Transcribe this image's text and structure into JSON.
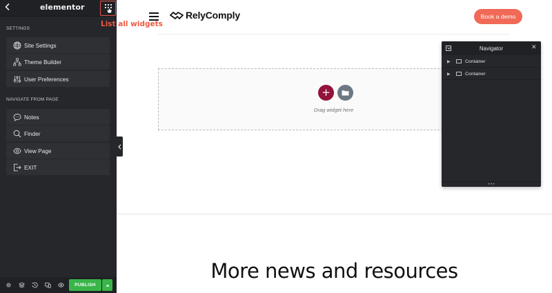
{
  "panel": {
    "logo": "elementor",
    "sections": {
      "settings": "SETTINGS",
      "navigate": "NAVIGATE FROM PAGE"
    },
    "settings_items": [
      {
        "label": "Site Settings",
        "icon": "globe-icon"
      },
      {
        "label": "Theme Builder",
        "icon": "sitemap-icon"
      },
      {
        "label": "User Preferences",
        "icon": "sliders-icon"
      }
    ],
    "navigate_items": [
      {
        "label": "Notes",
        "icon": "speech-bubble-icon"
      },
      {
        "label": "Finder",
        "icon": "search-icon"
      },
      {
        "label": "View Page",
        "icon": "eye-icon"
      },
      {
        "label": "EXIT",
        "icon": "exit-icon"
      }
    ],
    "footer": {
      "publish_label": "PUBLISH",
      "icons": [
        "gear-icon",
        "layers-icon",
        "history-icon",
        "responsive-icon",
        "eye-icon"
      ]
    }
  },
  "annotation": "List all widgets",
  "site": {
    "brand": "RelyComply",
    "cta": "Book a demo",
    "drop_hint": "Drag widget here",
    "headline": "More news and resources"
  },
  "navigator": {
    "title": "Navigator",
    "rows": [
      "Container",
      "Container"
    ]
  },
  "colors": {
    "panel_bg": "#26272b",
    "accent_orange": "#ef5a3f",
    "publish_green": "#39b54a",
    "add_button": "#93133a",
    "cta_coral": "#f06a57"
  }
}
